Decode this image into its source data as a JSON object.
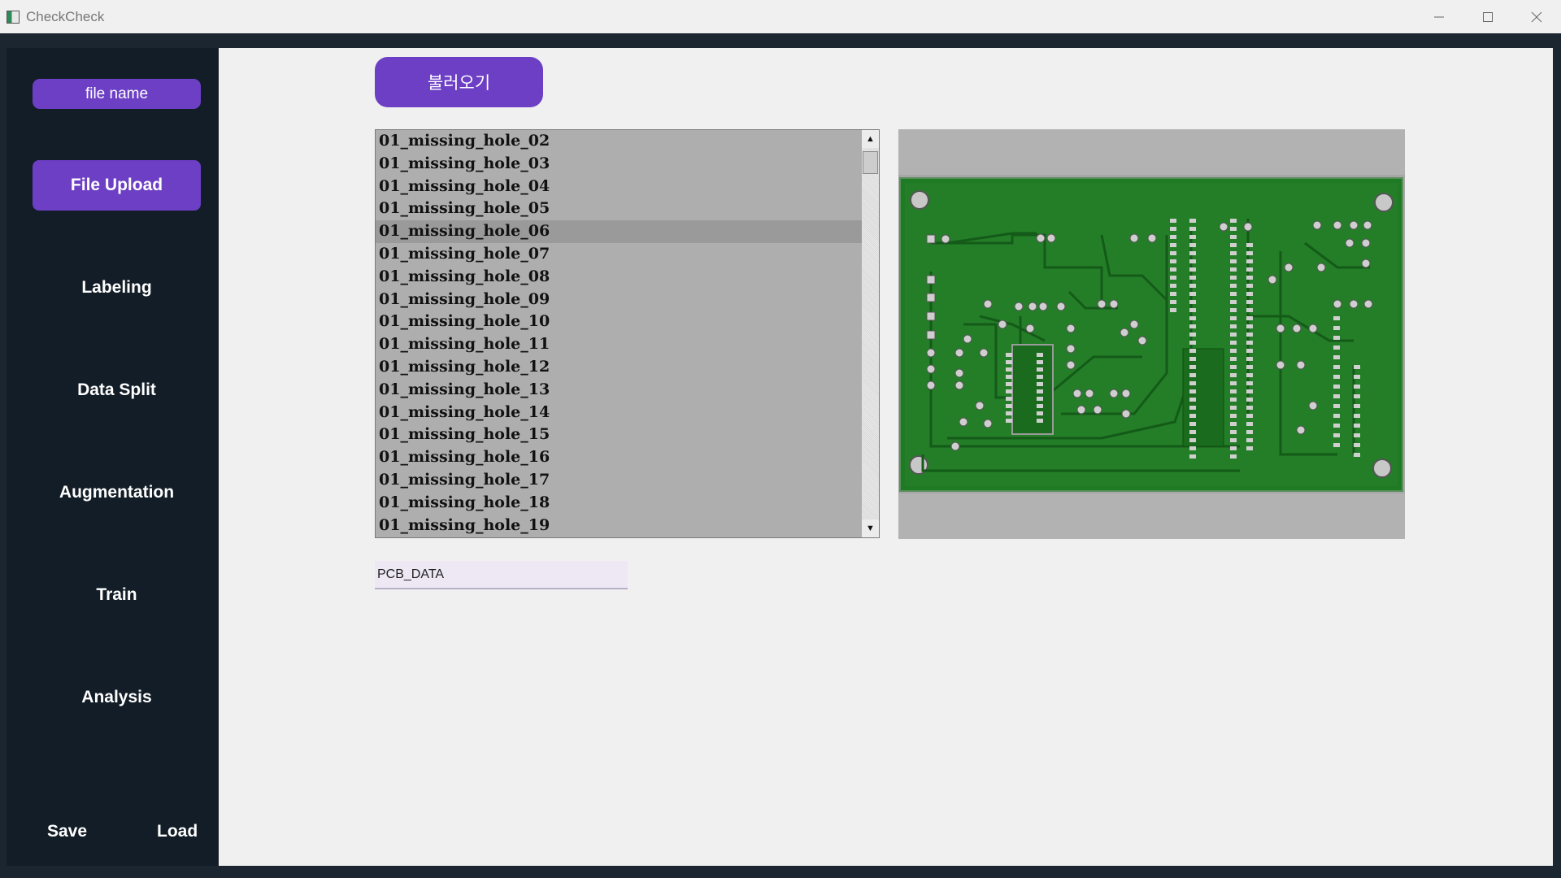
{
  "window": {
    "title": "CheckCheck",
    "minimize_glyph": "─",
    "maximize_glyph": "☐",
    "close_glyph": "✕"
  },
  "sidebar": {
    "file_name": "file name",
    "nav": [
      {
        "label": "File Upload",
        "active": true
      },
      {
        "label": "Labeling",
        "active": false
      },
      {
        "label": "Data Split",
        "active": false
      },
      {
        "label": "Augmentation",
        "active": false
      },
      {
        "label": "Train",
        "active": false
      },
      {
        "label": "Analysis",
        "active": false
      }
    ],
    "save_label": "Save",
    "load_label": "Load"
  },
  "main": {
    "load_button_label": "불러오기",
    "file_list": {
      "items": [
        "01_missing_hole_02",
        "01_missing_hole_03",
        "01_missing_hole_04",
        "01_missing_hole_05",
        "01_missing_hole_06",
        "01_missing_hole_07",
        "01_missing_hole_08",
        "01_missing_hole_09",
        "01_missing_hole_10",
        "01_missing_hole_11",
        "01_missing_hole_12",
        "01_missing_hole_13",
        "01_missing_hole_14",
        "01_missing_hole_15",
        "01_missing_hole_16",
        "01_missing_hole_17",
        "01_missing_hole_18",
        "01_missing_hole_19"
      ],
      "selected_index": 4,
      "scroll_up_glyph": "▲",
      "scroll_down_glyph": "▼"
    },
    "dataset_field_value": "PCB_DATA"
  },
  "colors": {
    "accent": "#6c3fc5",
    "sidebar_bg": "#121d27",
    "frame_bg": "#1b2631",
    "content_bg": "#f0f0f0",
    "pcb_green": "#1f7a24",
    "list_bg": "#aeaeae"
  },
  "icons": {
    "app": "app-icon",
    "preview": "pcb-board-image"
  }
}
